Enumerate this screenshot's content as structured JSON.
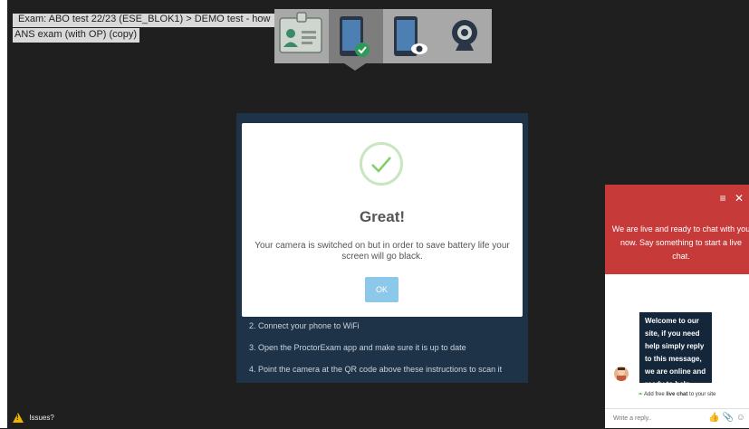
{
  "exam": {
    "title_line1": "Exam: ABO test 22/23 (ESE_BLOK1) > DEMO test - how",
    "title_line2": "ANS exam (with OP) (copy)"
  },
  "steps": [
    {
      "icon": "id-card-icon",
      "active": false
    },
    {
      "icon": "phone-check-icon",
      "active": true
    },
    {
      "icon": "phone-eye-icon",
      "active": false
    },
    {
      "icon": "webcam-icon",
      "active": false
    }
  ],
  "instructions": [
    "2. Connect your phone to WiFi",
    "3. Open the ProctorExam app and make sure it is up to date",
    "4. Point the camera at the QR code above these instructions to scan it"
  ],
  "modal": {
    "title": "Great!",
    "text": "Your camera is switched on but in order to save battery life your screen will go black.",
    "ok_label": "OK"
  },
  "chat": {
    "header_text": "We are live and ready to chat with you now. Say something to start a live chat.",
    "bubble_text": "Welcome to our site, if you need help simply reply to this message, we are online and ready to help.",
    "brand_prefix": "Add free",
    "brand_bold": "live chat",
    "brand_suffix": "to your site",
    "reply_placeholder": "Write a reply.."
  },
  "issues_label": "Issues?",
  "colors": {
    "chat_header": "#c73a3a",
    "chat_bubble": "#13263a",
    "ok_button": "#8cc8ea",
    "check": "#7fcf6a",
    "panel": "#1f3348"
  }
}
